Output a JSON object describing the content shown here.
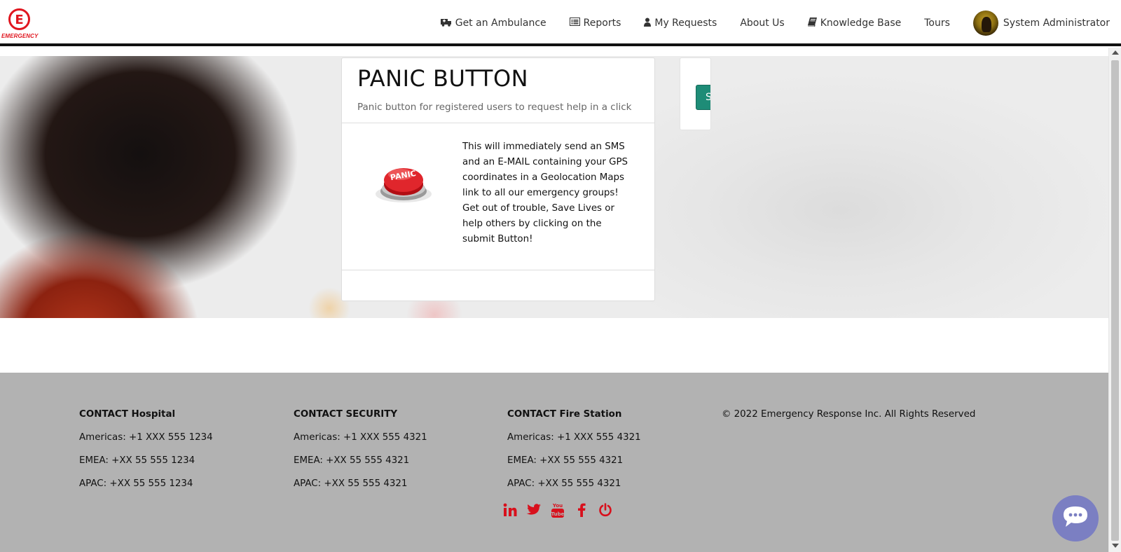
{
  "brand": {
    "logo_letter": "E",
    "logo_text": "EMERGENCY",
    "accent_color": "#e0161f"
  },
  "nav": {
    "items": [
      {
        "label": "Get an Ambulance",
        "icon": "ambulance-icon"
      },
      {
        "label": "Reports",
        "icon": "list-icon"
      },
      {
        "label": "My Requests",
        "icon": "user-icon"
      },
      {
        "label": "About Us"
      },
      {
        "label": "Knowledge Base",
        "icon": "book-icon"
      },
      {
        "label": "Tours"
      }
    ],
    "user_name": "System Administrator"
  },
  "panic_card": {
    "title": "PANIC BUTTON",
    "subtitle": "Panic button for registered users to request help in a click",
    "button_image_text": "PANIC",
    "description": "This will immediately send an SMS and an E-MAIL containing your GPS coordinates in a Geolocation Maps link to all our emergency groups! Get out of trouble, Save Lives or help others by clicking on the submit Button!"
  },
  "side_card": {
    "submit_label": "Submit",
    "button_color": "#1e8c77"
  },
  "footer": {
    "columns": [
      {
        "heading": "CONTACT Hospital",
        "lines": [
          "Americas: +1 XXX 555 1234",
          "EMEA: +XX 55 555 1234",
          "APAC: +XX 55 555 1234"
        ]
      },
      {
        "heading": "CONTACT SECURITY",
        "lines": [
          "Americas: +1 XXX 555 4321",
          "EMEA: +XX 55 555 4321",
          "APAC: +XX 55 555 4321"
        ]
      },
      {
        "heading": "CONTACT Fire Station",
        "lines": [
          "Americas: +1 XXX 555 4321",
          "EMEA: +XX 55 555 4321",
          "APAC: +XX 55 555 4321"
        ]
      }
    ],
    "copyright": "© 2022 Emergency Response Inc. All Rights Reserved",
    "social": [
      "linkedin-icon",
      "twitter-icon",
      "youtube-icon",
      "facebook-icon",
      "power-icon"
    ],
    "social_color": "#d8101c",
    "background": "#b2b2b2"
  },
  "chat": {
    "icon": "chat-icon",
    "color": "#7b7fc2"
  }
}
